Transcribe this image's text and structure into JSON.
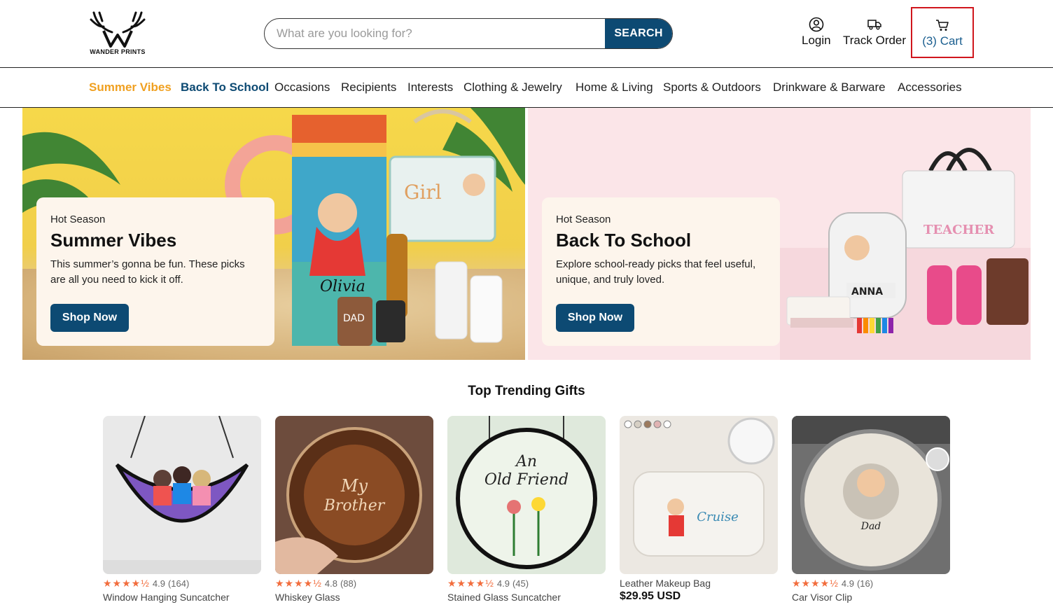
{
  "brand": {
    "logo_text": "WANDER PRINTS"
  },
  "search": {
    "placeholder": "What are you looking for?",
    "value": "",
    "button_label": "SEARCH"
  },
  "header": {
    "login_label": "Login",
    "track_order_label": "Track Order",
    "cart_label": "(3) Cart"
  },
  "nav": {
    "items": [
      "Summer Vibes",
      "Back To School",
      "Occasions",
      "Recipients",
      "Interests",
      "Clothing & Jewelry",
      "Home & Living",
      "Sports & Outdoors",
      "Drinkware & Barware",
      "Accessories"
    ]
  },
  "banners": [
    {
      "kicker": "Hot Season",
      "title": "Summer Vibes",
      "description": "This summer’s gonna be fun. These picks are all you need to kick it off.",
      "cta": "Shop Now"
    },
    {
      "kicker": "Hot Season",
      "title": "Back To School",
      "description": "Explore school-ready picks that feel useful, unique, and truly loved.",
      "cta": "Shop Now"
    }
  ],
  "trending": {
    "title": "Top Trending Gifts",
    "products": [
      {
        "stars": "★★★★½",
        "rating": "4.9",
        "count": "(164)",
        "name": "Window Hanging Suncatcher",
        "price": ""
      },
      {
        "stars": "★★★★½",
        "rating": "4.8",
        "count": "(88)",
        "name": "Whiskey Glass",
        "price": ""
      },
      {
        "stars": "★★★★½",
        "rating": "4.9",
        "count": "(45)",
        "name": "Stained Glass Suncatcher",
        "price": ""
      },
      {
        "stars": "",
        "rating": "",
        "count": "",
        "name": "Leather Makeup Bag",
        "price": "$29.95 USD"
      },
      {
        "stars": "★★★★½",
        "rating": "4.9",
        "count": "(16)",
        "name": "Car Visor Clip",
        "price": ""
      }
    ]
  },
  "colors": {
    "primary": "#0d4a73",
    "accent_orange": "#f0a020",
    "star": "#f26d3d",
    "cart_highlight": "#d0161d"
  },
  "icons": {
    "login": "user-circle-icon",
    "track": "truck-icon",
    "cart": "cart-icon"
  }
}
